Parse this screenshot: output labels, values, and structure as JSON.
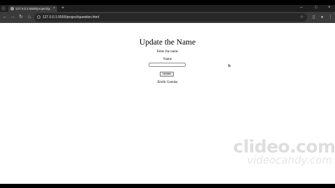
{
  "browser": {
    "tab_title": "127.0.0.1:5500/project/questi...",
    "tab_close_glyph": "×",
    "new_tab_glyph": "+",
    "url": "127.0.0.1:5500/project/question.html",
    "window_controls": [
      "–",
      "□",
      "×"
    ]
  },
  "page": {
    "heading": "Update the Name",
    "prompt": "Enter the name",
    "field_label": "Name",
    "input_value": "",
    "button_label": "Update",
    "current_name": "Kirtik Goenka"
  },
  "watermark": {
    "brand": "clideo.com",
    "sub": "videocandy.com"
  },
  "colors": {
    "tab_strip": "#1f1f1f",
    "toolbar": "#3b3b3b",
    "page_background": "#ffffff",
    "letterbox": "#000000"
  }
}
